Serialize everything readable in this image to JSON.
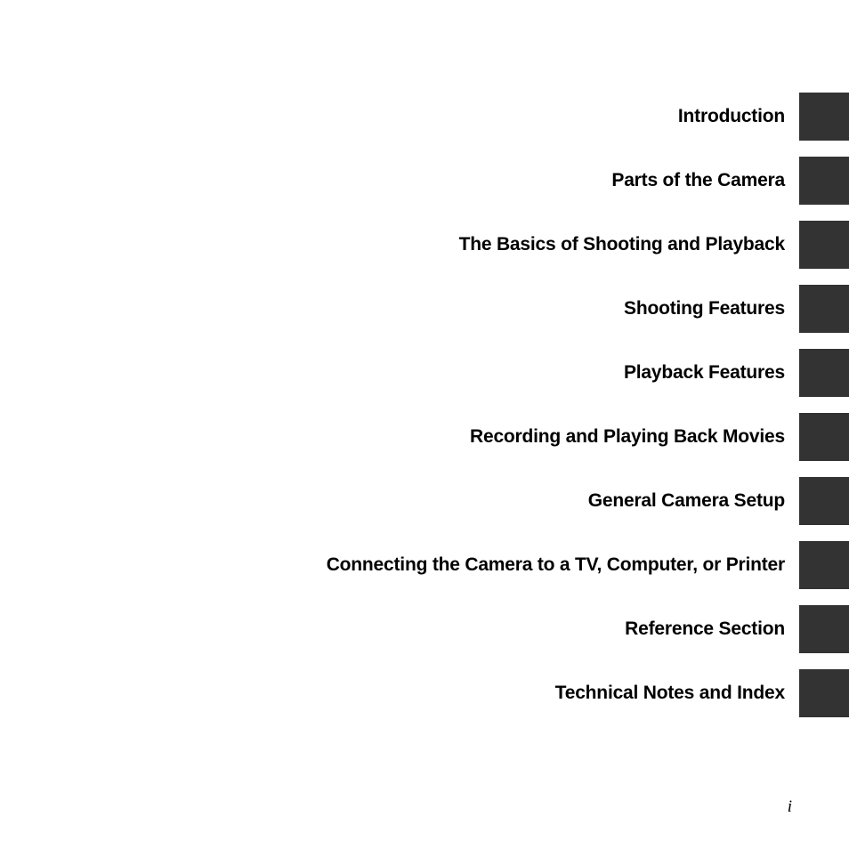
{
  "document": {
    "type": "section-tab-index",
    "page_number": "i",
    "tab_color": "#333333",
    "text_color": "#000000",
    "background_color": "#ffffff"
  },
  "chapters": [
    {
      "label": "Introduction"
    },
    {
      "label": "Parts of the Camera"
    },
    {
      "label": "The Basics of Shooting and Playback"
    },
    {
      "label": "Shooting Features"
    },
    {
      "label": "Playback Features"
    },
    {
      "label": "Recording and Playing Back Movies"
    },
    {
      "label": "General Camera Setup"
    },
    {
      "label": "Connecting the Camera to a TV, Computer, or Printer"
    },
    {
      "label": "Reference Section"
    },
    {
      "label": "Technical Notes and Index"
    }
  ]
}
